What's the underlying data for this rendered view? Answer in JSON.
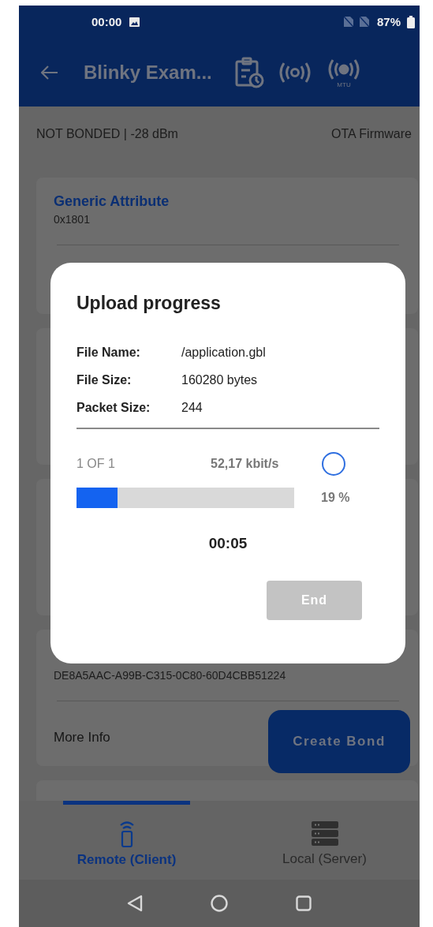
{
  "status_bar": {
    "time": "00:00",
    "battery": "87%"
  },
  "app_bar": {
    "title": "Blinky Exam...",
    "mtu_label": "MTU"
  },
  "info_strip": {
    "status": "NOT BONDED | -28 dBm",
    "action": "OTA Firmware"
  },
  "cards": [
    {
      "kind": "service",
      "title": "Generic Attribute",
      "uuid": "0x1801"
    },
    {
      "kind": "covered"
    },
    {
      "kind": "covered"
    },
    {
      "kind": "detail",
      "uuid": "DE8A5AAC-A99B-C315-0C80-60D4CBB51224",
      "link": "More Info"
    },
    {
      "kind": "covered"
    }
  ],
  "create_bond_button": "Create Bond",
  "dialog": {
    "title": "Upload progress",
    "fields": [
      {
        "label": "File Name:",
        "value": "/application.gbl"
      },
      {
        "label": "File Size:",
        "value": "160280 bytes"
      },
      {
        "label": "Packet Size:",
        "value": "244"
      }
    ],
    "file_count": "1 OF 1",
    "speed": "52,17 kbit/s",
    "level": 0.19,
    "percent": "19 %",
    "elapsed": "00:05",
    "end_button": {
      "label": "End",
      "disabled": true
    }
  },
  "bottom_nav": [
    {
      "kind": "remote",
      "label": "Remote (Client)",
      "selected": true
    },
    {
      "kind": "server",
      "label": "Local (Server)",
      "selected": false
    }
  ]
}
